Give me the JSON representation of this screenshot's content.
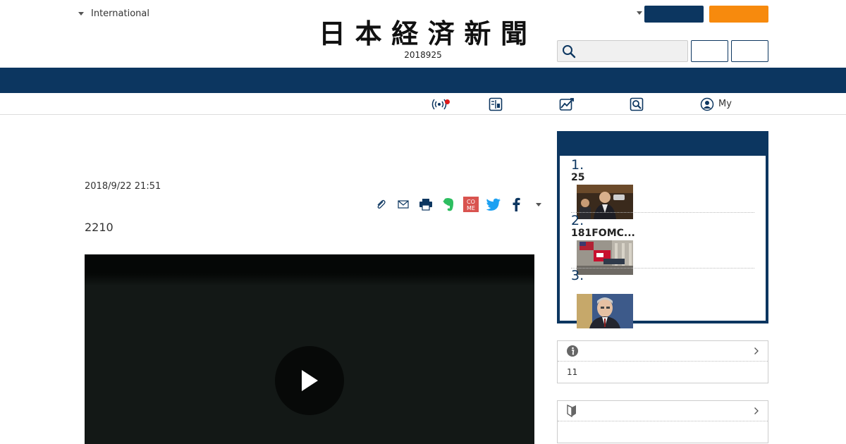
{
  "header": {
    "edition_label": "International",
    "logo_text": [
      "日",
      "本",
      "経",
      "済",
      "新",
      "聞"
    ],
    "issue_date": "2018925",
    "search": {
      "placeholder": ""
    },
    "colors": {
      "navy": "#0c3660",
      "orange": "#f78a0d"
    }
  },
  "subnav": {
    "items": [
      {
        "icon": "broadcast-icon",
        "label": ""
      },
      {
        "icon": "newspaper-icon",
        "label": ""
      },
      {
        "icon": "chart-icon",
        "label": ""
      },
      {
        "icon": "search-doc-icon",
        "label": ""
      },
      {
        "icon": "user-icon",
        "label": "My"
      }
    ]
  },
  "article": {
    "timestamp": "2018/9/22 21:51",
    "lead": "2210",
    "share_icons": [
      "clip-icon",
      "mail-icon",
      "print-icon",
      "evernote-icon",
      "come-icon",
      "twitter-icon",
      "facebook-icon",
      "more-caret-icon"
    ],
    "come_icon_text": [
      "CO",
      "ME"
    ]
  },
  "ranking": {
    "items": [
      {
        "rank": "1.",
        "title": "25"
      },
      {
        "rank": "2.",
        "title": "181FOMC..."
      },
      {
        "rank": "3.",
        "title": ""
      }
    ]
  },
  "info_boxes": [
    {
      "icon": "info-icon",
      "title": "",
      "body": "11"
    },
    {
      "icon": "beginner-icon",
      "title": "",
      "body": ""
    }
  ]
}
